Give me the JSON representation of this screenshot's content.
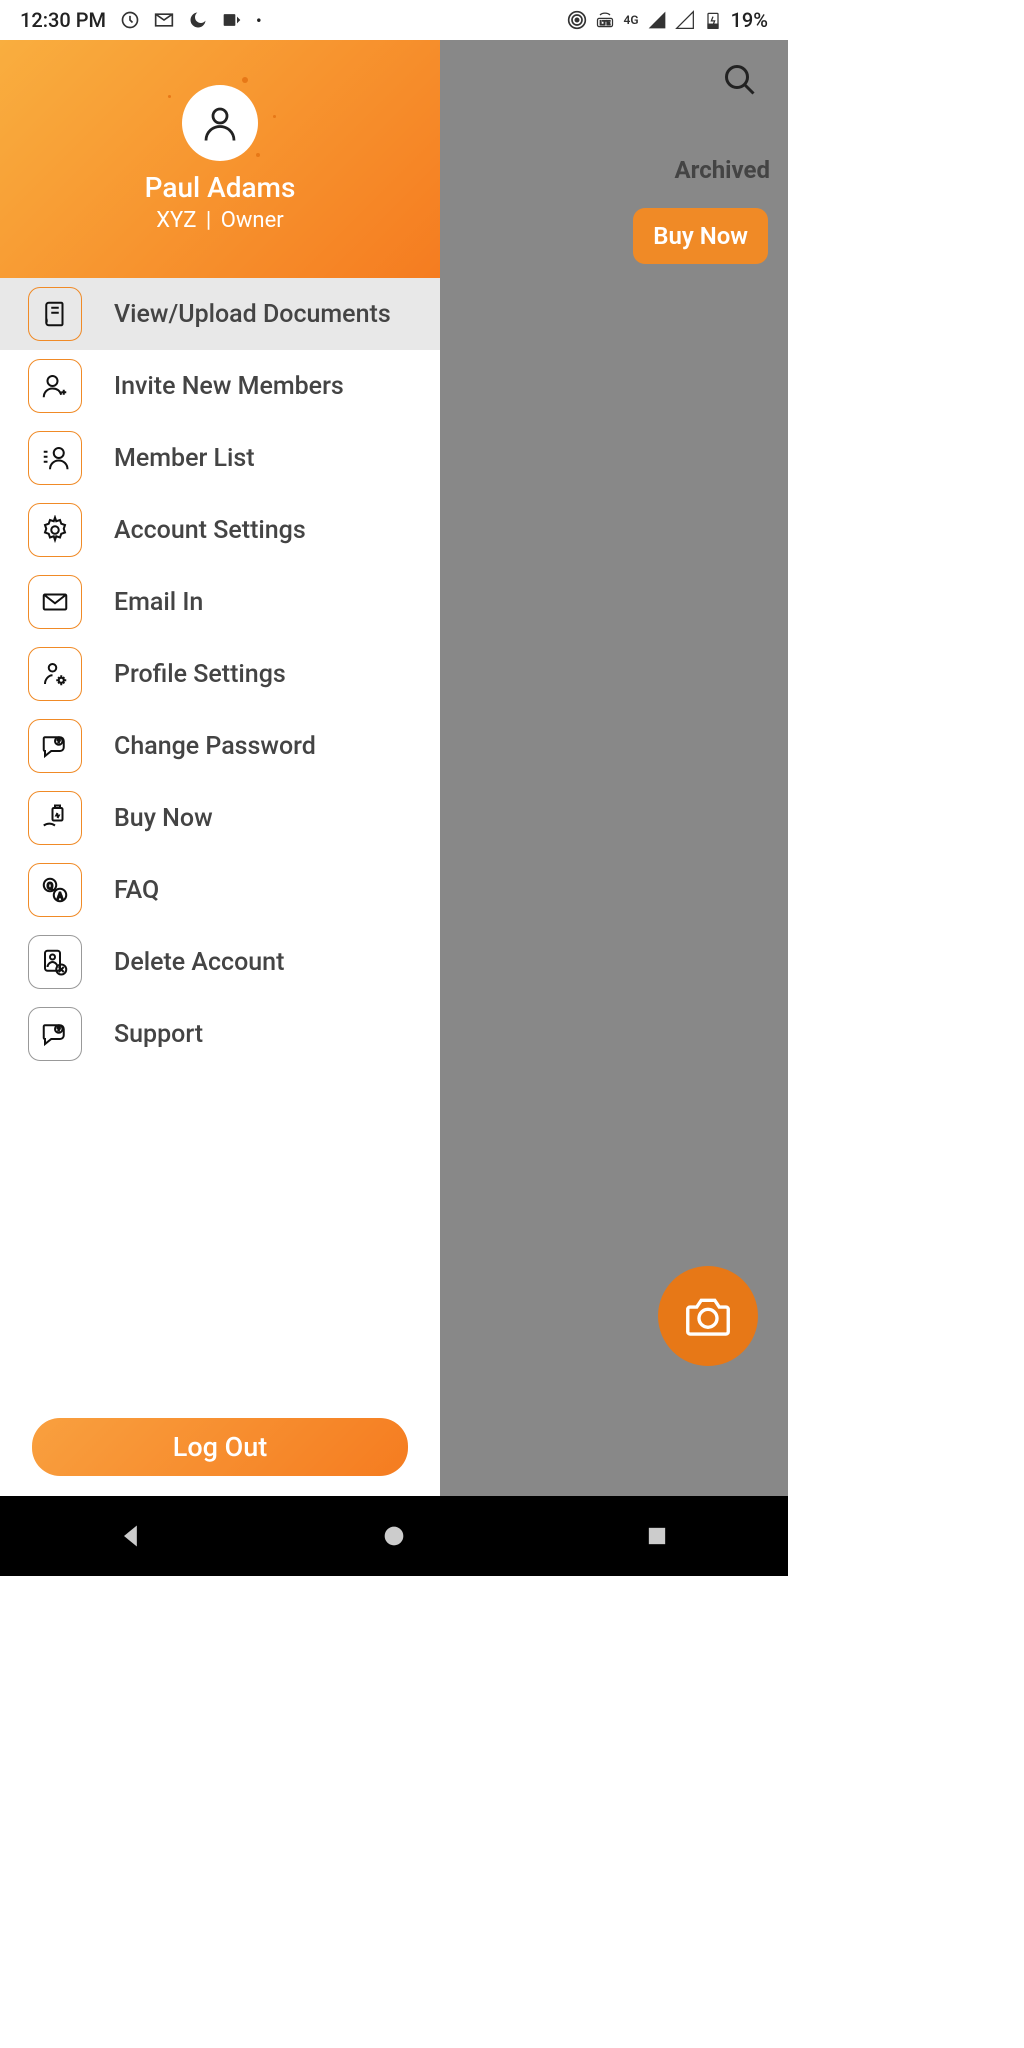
{
  "statusBar": {
    "time": "12:30 PM",
    "battery": "19%"
  },
  "backdrop": {
    "searchPlaceholder": "",
    "tabArchived": "Archived",
    "buyNowLabel": "Buy Now"
  },
  "drawer": {
    "userName": "Paul Adams",
    "userOrg": "XYZ",
    "userRole": "Owner",
    "items": [
      {
        "label": "View/Upload Documents",
        "icon": "document",
        "selected": true
      },
      {
        "label": "Invite New Members",
        "icon": "user-plus",
        "selected": false
      },
      {
        "label": "Member List",
        "icon": "member-list",
        "selected": false
      },
      {
        "label": "Account Settings",
        "icon": "gear",
        "selected": false
      },
      {
        "label": "Email In",
        "icon": "envelope",
        "selected": false
      },
      {
        "label": "Profile Settings",
        "icon": "user-gear",
        "selected": false
      },
      {
        "label": "Change Password",
        "icon": "chat-question",
        "selected": false
      },
      {
        "label": "Buy Now",
        "icon": "buy",
        "selected": false
      },
      {
        "label": "FAQ",
        "icon": "qa",
        "selected": false
      },
      {
        "label": "Delete Account",
        "icon": "user-delete",
        "selected": false,
        "iconGrey": true
      },
      {
        "label": "Support",
        "icon": "chat-question",
        "selected": false,
        "iconGrey": true
      }
    ],
    "logoutLabel": "Log Out"
  }
}
